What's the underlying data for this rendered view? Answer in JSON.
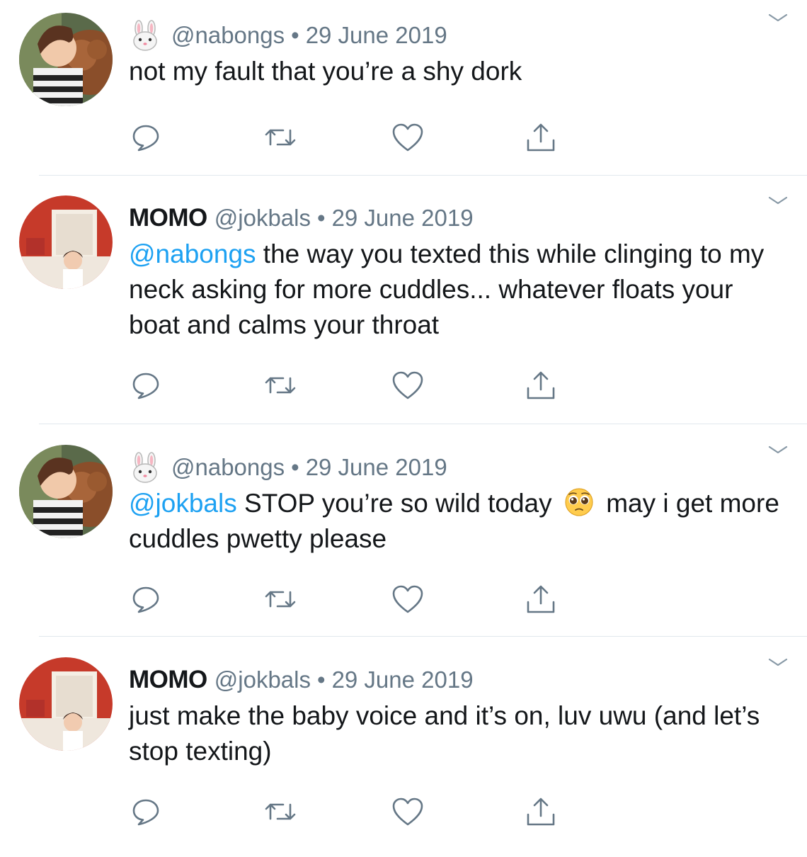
{
  "colors": {
    "text": "#14171a",
    "secondary": "#657786",
    "mention": "#1da1f2",
    "divider": "#e1e8ed",
    "icon": "#657786"
  },
  "tweets": [
    {
      "display_name": "",
      "name_icon": "rabbit-face-emoji",
      "handle": "@nabongs",
      "separator": "•",
      "date": "29 June 2019",
      "mention": "",
      "text": "not my fault that you’re a shy dork",
      "text_after_emoji": "",
      "avatar": "nabongs-avatar",
      "actions": [
        "reply-icon",
        "retweet-icon",
        "like-icon",
        "share-icon"
      ]
    },
    {
      "display_name": "MOMO",
      "name_icon": "",
      "handle": "@jokbals",
      "separator": "•",
      "date": "29 June 2019",
      "mention": "@nabongs",
      "text": " the way you texted this while clinging to my neck asking for more cuddles... whatever floats your boat and calms your throat",
      "text_after_emoji": "",
      "avatar": "jokbals-avatar",
      "actions": [
        "reply-icon",
        "retweet-icon",
        "like-icon",
        "share-icon"
      ]
    },
    {
      "display_name": "",
      "name_icon": "rabbit-face-emoji",
      "handle": "@nabongs",
      "separator": "•",
      "date": "29 June 2019",
      "mention": "@jokbals",
      "text": " STOP you’re so wild today ",
      "inline_emoji": "pleading-face-emoji",
      "text_after_emoji": " may i get more cuddles pwetty please",
      "avatar": "nabongs-avatar",
      "actions": [
        "reply-icon",
        "retweet-icon",
        "like-icon",
        "share-icon"
      ]
    },
    {
      "display_name": "MOMO",
      "name_icon": "",
      "handle": "@jokbals",
      "separator": "•",
      "date": "29 June 2019",
      "mention": "",
      "text": "just make the baby voice and it’s on, luv uwu (and let’s stop texting)",
      "text_after_emoji": "",
      "avatar": "jokbals-avatar",
      "actions": [
        "reply-icon",
        "retweet-icon",
        "like-icon",
        "share-icon"
      ]
    }
  ]
}
